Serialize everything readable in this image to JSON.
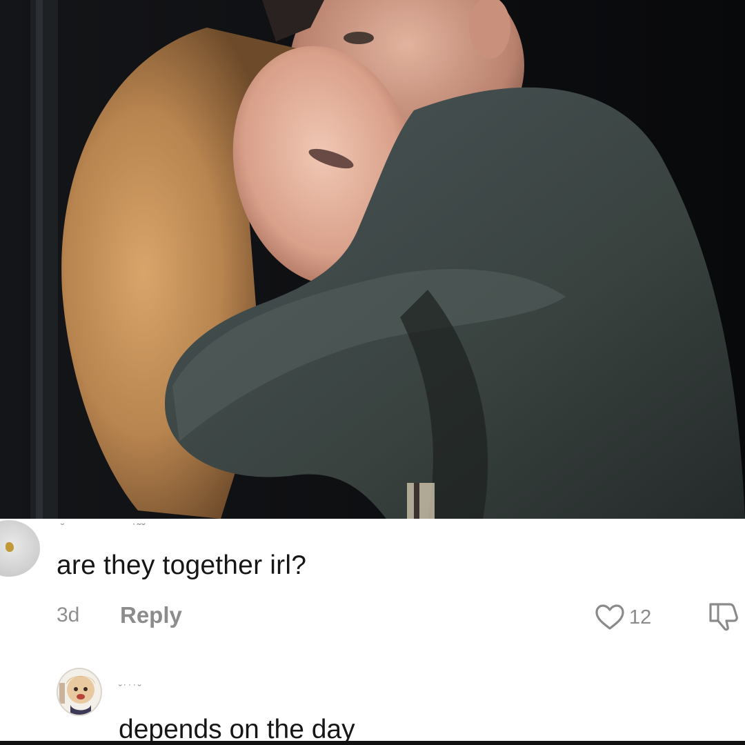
{
  "colors": {
    "photo_background": "#0b0c0e",
    "text_primary": "#161616",
    "text_secondary": "#8e8e8e",
    "like_icon": "#8a8a8a"
  },
  "photo": {
    "icon": "photo-of-couple-embracing"
  },
  "comments": [
    {
      "username": "˘",
      "username_suffix": "˙˜˘",
      "text": "are they together irl?",
      "age": "3d",
      "reply_label": "Reply",
      "like_count": "12",
      "like_icon": "heart-outline-icon",
      "dislike_icon": "thumbs-down-icon"
    },
    {
      "username": "˘˙˙˙˘",
      "text": "depends on the day",
      "avatar_icon": "profile-avatar-icon"
    }
  ]
}
